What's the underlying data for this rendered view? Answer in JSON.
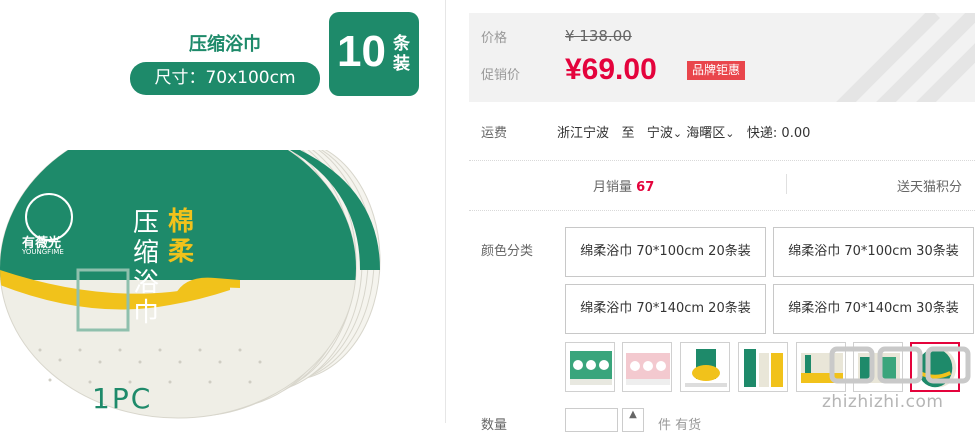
{
  "product_image": {
    "name_label": "压缩浴巾",
    "size_label": "尺寸：70x100cm",
    "count": "10",
    "count_unit": "条装",
    "brand_name": "有薇光",
    "brand_sub": "YOUNGFIME",
    "vertical_white": "压缩浴巾",
    "vertical_yellow": "棉柔",
    "pc_label": "1PC",
    "colors": {
      "green": "#1e8a6a",
      "yellow": "#f1c21b"
    }
  },
  "price": {
    "label": "价格",
    "original": "¥ 138.00",
    "promo_label": "促销价",
    "promo": "¥69.00",
    "badge": "品牌钜惠"
  },
  "shipping": {
    "label": "运费",
    "from": "浙江宁波",
    "to_word": "至",
    "city": "宁波",
    "district": "海曙区",
    "express": "快递: 0.00"
  },
  "stats": {
    "monthly_label": "月销量",
    "monthly_value": "67",
    "points_label": "送天猫积分"
  },
  "sku": {
    "label": "颜色分类",
    "options": [
      "绵柔浴巾 70*100cm 20条装",
      "绵柔浴巾 70*100cm 30条装",
      "绵柔浴巾 70*140cm 20条装",
      "绵柔浴巾 70*140cm 30条装"
    ],
    "thumbnails": [
      "thumb-1",
      "thumb-2",
      "thumb-3",
      "thumb-4",
      "thumb-5",
      "thumb-6",
      "thumb-7"
    ]
  },
  "quantity": {
    "label": "数量",
    "stock": "件 有货"
  },
  "watermark": "zhizhizhi.com",
  "colors": {
    "accent": "#e4033c",
    "badge": "#e9464c",
    "panel_bg": "#f2f2f2"
  }
}
